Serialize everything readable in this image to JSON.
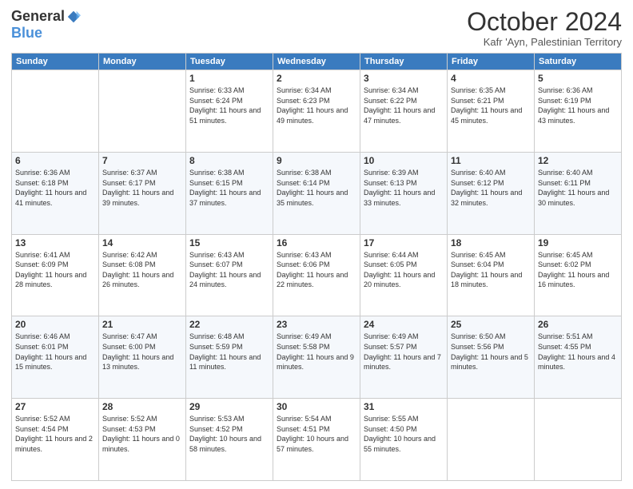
{
  "header": {
    "logo_general": "General",
    "logo_blue": "Blue",
    "month_title": "October 2024",
    "subtitle": "Kafr 'Ayn, Palestinian Territory"
  },
  "days_of_week": [
    "Sunday",
    "Monday",
    "Tuesday",
    "Wednesday",
    "Thursday",
    "Friday",
    "Saturday"
  ],
  "weeks": [
    [
      {
        "day": "",
        "info": ""
      },
      {
        "day": "",
        "info": ""
      },
      {
        "day": "1",
        "info": "Sunrise: 6:33 AM\nSunset: 6:24 PM\nDaylight: 11 hours and 51 minutes."
      },
      {
        "day": "2",
        "info": "Sunrise: 6:34 AM\nSunset: 6:23 PM\nDaylight: 11 hours and 49 minutes."
      },
      {
        "day": "3",
        "info": "Sunrise: 6:34 AM\nSunset: 6:22 PM\nDaylight: 11 hours and 47 minutes."
      },
      {
        "day": "4",
        "info": "Sunrise: 6:35 AM\nSunset: 6:21 PM\nDaylight: 11 hours and 45 minutes."
      },
      {
        "day": "5",
        "info": "Sunrise: 6:36 AM\nSunset: 6:19 PM\nDaylight: 11 hours and 43 minutes."
      }
    ],
    [
      {
        "day": "6",
        "info": "Sunrise: 6:36 AM\nSunset: 6:18 PM\nDaylight: 11 hours and 41 minutes."
      },
      {
        "day": "7",
        "info": "Sunrise: 6:37 AM\nSunset: 6:17 PM\nDaylight: 11 hours and 39 minutes."
      },
      {
        "day": "8",
        "info": "Sunrise: 6:38 AM\nSunset: 6:15 PM\nDaylight: 11 hours and 37 minutes."
      },
      {
        "day": "9",
        "info": "Sunrise: 6:38 AM\nSunset: 6:14 PM\nDaylight: 11 hours and 35 minutes."
      },
      {
        "day": "10",
        "info": "Sunrise: 6:39 AM\nSunset: 6:13 PM\nDaylight: 11 hours and 33 minutes."
      },
      {
        "day": "11",
        "info": "Sunrise: 6:40 AM\nSunset: 6:12 PM\nDaylight: 11 hours and 32 minutes."
      },
      {
        "day": "12",
        "info": "Sunrise: 6:40 AM\nSunset: 6:11 PM\nDaylight: 11 hours and 30 minutes."
      }
    ],
    [
      {
        "day": "13",
        "info": "Sunrise: 6:41 AM\nSunset: 6:09 PM\nDaylight: 11 hours and 28 minutes."
      },
      {
        "day": "14",
        "info": "Sunrise: 6:42 AM\nSunset: 6:08 PM\nDaylight: 11 hours and 26 minutes."
      },
      {
        "day": "15",
        "info": "Sunrise: 6:43 AM\nSunset: 6:07 PM\nDaylight: 11 hours and 24 minutes."
      },
      {
        "day": "16",
        "info": "Sunrise: 6:43 AM\nSunset: 6:06 PM\nDaylight: 11 hours and 22 minutes."
      },
      {
        "day": "17",
        "info": "Sunrise: 6:44 AM\nSunset: 6:05 PM\nDaylight: 11 hours and 20 minutes."
      },
      {
        "day": "18",
        "info": "Sunrise: 6:45 AM\nSunset: 6:04 PM\nDaylight: 11 hours and 18 minutes."
      },
      {
        "day": "19",
        "info": "Sunrise: 6:45 AM\nSunset: 6:02 PM\nDaylight: 11 hours and 16 minutes."
      }
    ],
    [
      {
        "day": "20",
        "info": "Sunrise: 6:46 AM\nSunset: 6:01 PM\nDaylight: 11 hours and 15 minutes."
      },
      {
        "day": "21",
        "info": "Sunrise: 6:47 AM\nSunset: 6:00 PM\nDaylight: 11 hours and 13 minutes."
      },
      {
        "day": "22",
        "info": "Sunrise: 6:48 AM\nSunset: 5:59 PM\nDaylight: 11 hours and 11 minutes."
      },
      {
        "day": "23",
        "info": "Sunrise: 6:49 AM\nSunset: 5:58 PM\nDaylight: 11 hours and 9 minutes."
      },
      {
        "day": "24",
        "info": "Sunrise: 6:49 AM\nSunset: 5:57 PM\nDaylight: 11 hours and 7 minutes."
      },
      {
        "day": "25",
        "info": "Sunrise: 6:50 AM\nSunset: 5:56 PM\nDaylight: 11 hours and 5 minutes."
      },
      {
        "day": "26",
        "info": "Sunrise: 5:51 AM\nSunset: 4:55 PM\nDaylight: 11 hours and 4 minutes."
      }
    ],
    [
      {
        "day": "27",
        "info": "Sunrise: 5:52 AM\nSunset: 4:54 PM\nDaylight: 11 hours and 2 minutes."
      },
      {
        "day": "28",
        "info": "Sunrise: 5:52 AM\nSunset: 4:53 PM\nDaylight: 11 hours and 0 minutes."
      },
      {
        "day": "29",
        "info": "Sunrise: 5:53 AM\nSunset: 4:52 PM\nDaylight: 10 hours and 58 minutes."
      },
      {
        "day": "30",
        "info": "Sunrise: 5:54 AM\nSunset: 4:51 PM\nDaylight: 10 hours and 57 minutes."
      },
      {
        "day": "31",
        "info": "Sunrise: 5:55 AM\nSunset: 4:50 PM\nDaylight: 10 hours and 55 minutes."
      },
      {
        "day": "",
        "info": ""
      },
      {
        "day": "",
        "info": ""
      }
    ]
  ]
}
